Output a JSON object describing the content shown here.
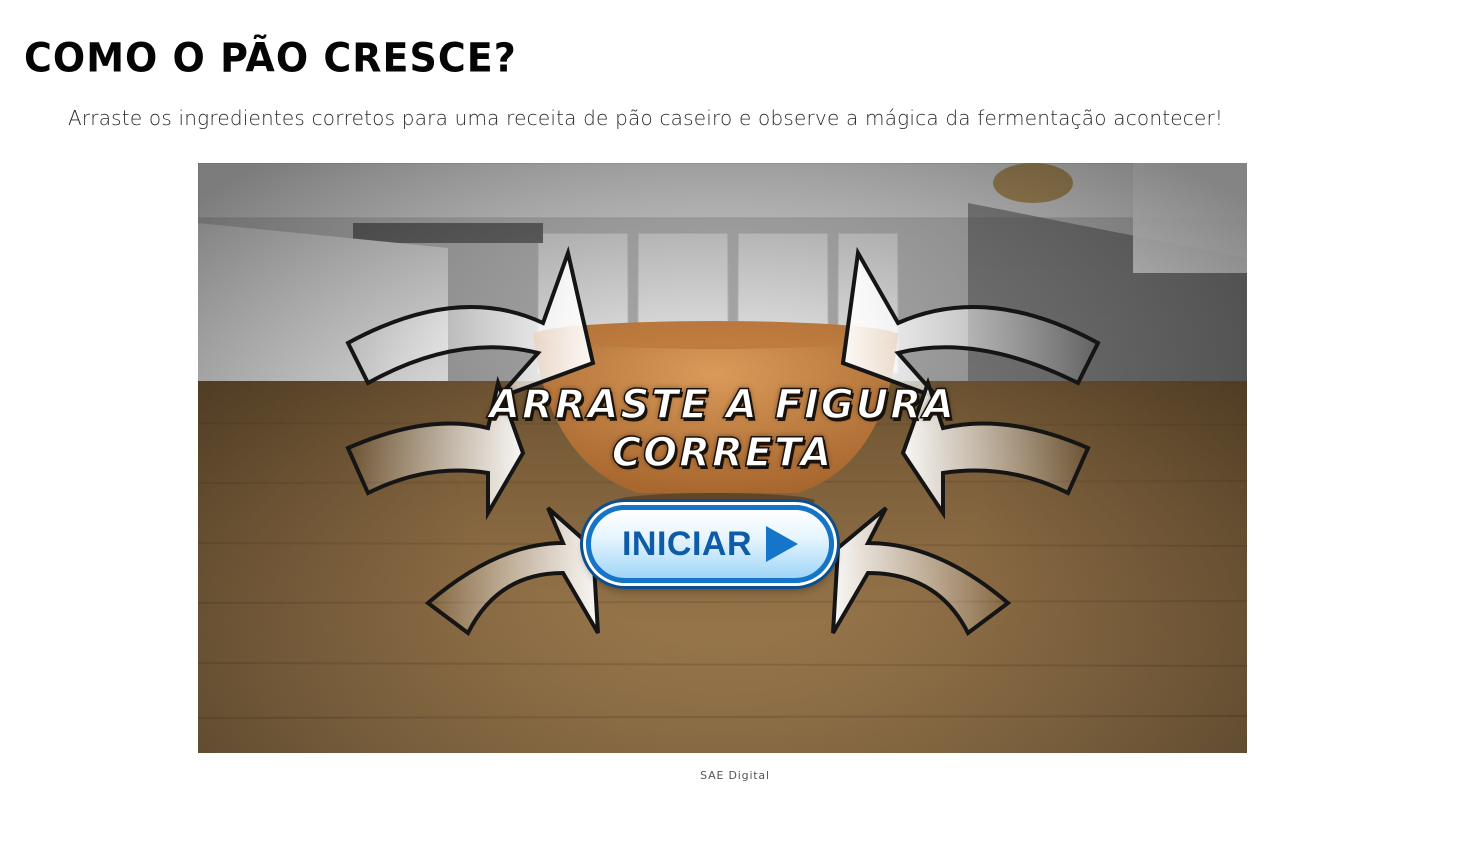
{
  "page": {
    "title": "COMO O PÃO CRESCE?",
    "subtitle": "Arraste os ingredientes corretos para uma receita de pão caseiro e observe a mágica da fermentação acontecer!",
    "caption": "SAE Digital"
  },
  "game": {
    "instruction_line1": "ARRASTE A FIGURA",
    "instruction_line2": "CORRETA",
    "start_button_label": "INICIAR",
    "start_button_icon": "play-icon",
    "colors": {
      "button_border": "#1576c9",
      "button_text": "#0e5ba8",
      "wood": "#8a6a42",
      "bowl": "#c98846"
    }
  }
}
